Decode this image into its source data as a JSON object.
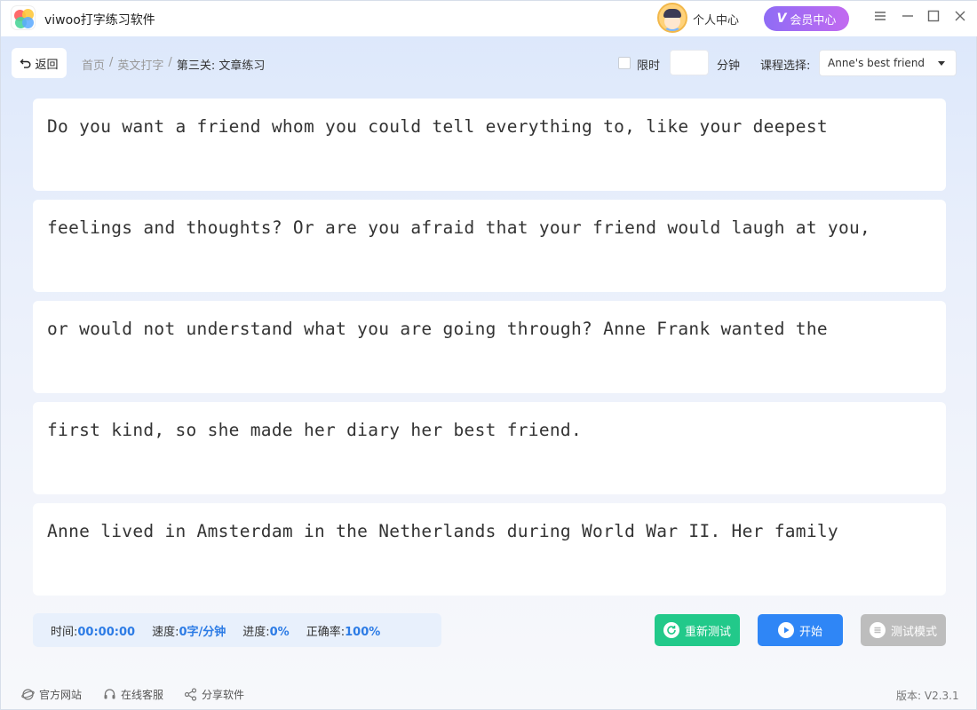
{
  "app": {
    "title": "viwoo打字练习软件"
  },
  "header": {
    "user_center": "个人中心",
    "vip_label": "会员中心",
    "vip_badge": "V"
  },
  "toolbar": {
    "back_label": "返回",
    "breadcrumb": [
      "首页",
      "英文打字",
      "第三关: 文章练习"
    ],
    "limit_label": "限时",
    "limit_checked": false,
    "minutes_value": "",
    "minutes_unit": "分钟",
    "course_label": "课程选择:",
    "course_selected": "Anne's best friend"
  },
  "lines": [
    "Do you want a friend whom you could tell everything to, like your deepest",
    "feelings and thoughts? Or are you afraid that your friend would laugh at you,",
    "or would not understand what you are going through? Anne Frank wanted the",
    "first kind, so she made her diary her best friend.",
    "Anne lived in Amsterdam in the Netherlands during World War II. Her family"
  ],
  "stats": {
    "time_label": "时间:",
    "time_value": "00:00:00",
    "speed_label": "速度:",
    "speed_value": "0字/分钟",
    "progress_label": "进度:",
    "progress_value": "0%",
    "accuracy_label": "正确率:",
    "accuracy_value": "100%"
  },
  "actions": {
    "retest": "重新测试",
    "start": "开始",
    "test_mode": "测试模式"
  },
  "footer": {
    "website": "官方网站",
    "support": "在线客服",
    "share": "分享软件",
    "version": "版本: V2.3.1"
  },
  "colors": {
    "accent": "#2f86f6",
    "success": "#22c98a",
    "vip_start": "#8f6cf5",
    "vip_end": "#c26af0",
    "disabled": "#bdbdbd"
  }
}
